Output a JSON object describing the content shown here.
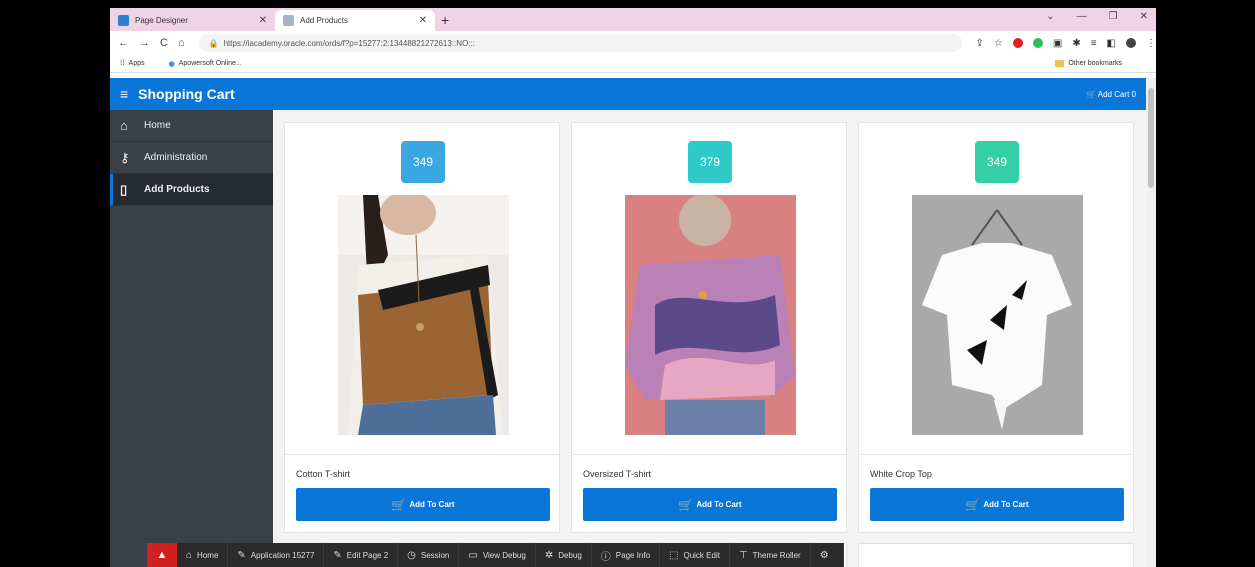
{
  "browser": {
    "tabs": [
      {
        "label": "Page Designer",
        "icon": "page-designer-icon"
      },
      {
        "label": "Add Products",
        "icon": "apex-icon"
      }
    ],
    "url": "https://iacademy.oracle.com/ords/f?p=15277:2:13448821272613::NO:::",
    "bookmarks": [
      {
        "label": "Apps"
      },
      {
        "label": "Apowersoft Online..."
      }
    ],
    "other_bookmarks": "Other bookmarks"
  },
  "header": {
    "title": "Shopping Cart",
    "cart_label": "Add Cart 0"
  },
  "sidebar": {
    "items": [
      {
        "label": "Home"
      },
      {
        "label": "Administration"
      },
      {
        "label": "Add Products"
      }
    ]
  },
  "products": [
    {
      "price": "349",
      "name": "Cotton T-shirt",
      "button": "Add To Cart",
      "badge_color": "#3aa7e0"
    },
    {
      "price": "379",
      "name": "Oversized T-shirt",
      "button": "Add To Cart",
      "badge_color": "#2ec9c8"
    },
    {
      "price": "349",
      "name": "White Crop Top",
      "button": "Add To Cart",
      "badge_color": "#35cfa7"
    }
  ],
  "devbar": {
    "items": [
      {
        "label": "Home"
      },
      {
        "label": "Application 15277"
      },
      {
        "label": "Edit Page 2"
      },
      {
        "label": "Session"
      },
      {
        "label": "View Debug"
      },
      {
        "label": "Debug"
      },
      {
        "label": "Page Info"
      },
      {
        "label": "Quick Edit"
      },
      {
        "label": "Theme Roller"
      }
    ]
  }
}
